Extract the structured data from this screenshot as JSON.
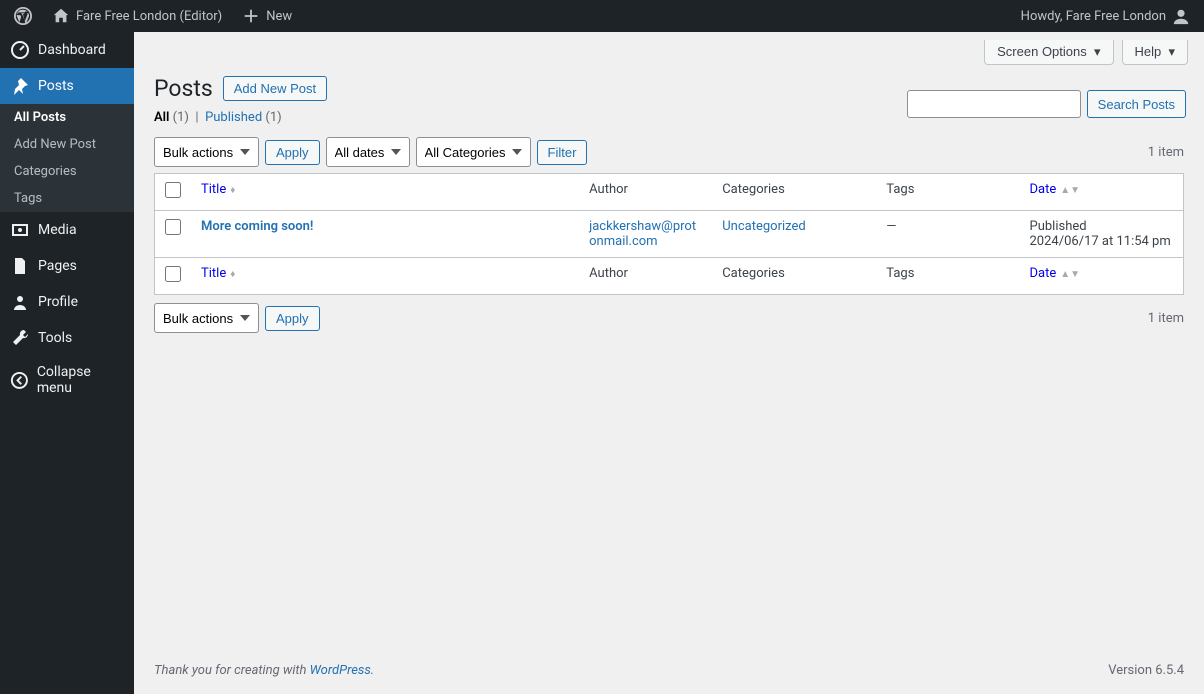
{
  "adminBar": {
    "siteName": "Fare Free London (Editor)",
    "newLabel": "New",
    "howdy": "Howdy, Fare Free London"
  },
  "sidebar": {
    "dashboard": "Dashboard",
    "posts": "Posts",
    "postsSub": {
      "all": "All Posts",
      "add": "Add New Post",
      "categories": "Categories",
      "tags": "Tags"
    },
    "media": "Media",
    "pages": "Pages",
    "profile": "Profile",
    "tools": "Tools",
    "collapse": "Collapse menu"
  },
  "page": {
    "heading": "Posts",
    "addNew": "Add New Post",
    "screenOptions": "Screen Options",
    "help": "Help"
  },
  "filters": {
    "allLabel": "All",
    "allCount": "(1)",
    "separator": "|",
    "publishedLabel": "Published",
    "publishedCount": "(1)"
  },
  "search": {
    "submit": "Search Posts"
  },
  "tablenav": {
    "bulkActions": "Bulk actions",
    "apply": "Apply",
    "allDates": "All dates",
    "allCategories": "All Categories",
    "filter": "Filter",
    "itemCount": "1 item"
  },
  "columns": {
    "title": "Title",
    "author": "Author",
    "categories": "Categories",
    "tags": "Tags",
    "date": "Date"
  },
  "rows": [
    {
      "title": "More coming soon!",
      "author": "jackkershaw@protonmail.com",
      "categories": "Uncategorized",
      "tags": "—",
      "dateStatus": "Published",
      "dateValue": "2024/06/17 at 11:54 pm"
    }
  ],
  "footer": {
    "thanksPrefix": "Thank you for creating with ",
    "wordpress": "WordPress",
    "period": ".",
    "version": "Version 6.5.4"
  }
}
